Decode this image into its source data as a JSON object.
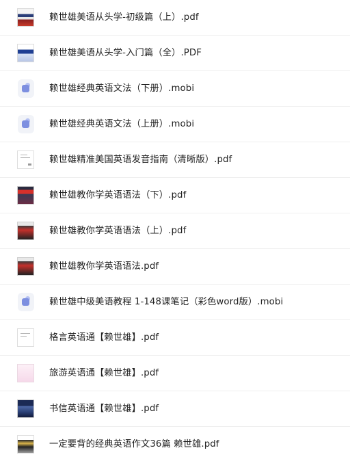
{
  "files": [
    {
      "name": "赖世雄美语从头学-初级篇（上）.pdf",
      "thumb": "book-cover-thumbnail"
    },
    {
      "name": "赖世雄美语从头学-入门篇（全）.PDF",
      "thumb": "book-cover-thumbnail"
    },
    {
      "name": "赖世雄经典英语文法（下册）.mobi",
      "thumb": "mobi-file-icon"
    },
    {
      "name": "赖世雄经典英语文法（上册）.mobi",
      "thumb": "mobi-file-icon"
    },
    {
      "name": "赖世雄精准美国英语发音指南（清晰版）.pdf",
      "thumb": "document-page-thumbnail"
    },
    {
      "name": "赖世雄教你学英语语法（下）.pdf",
      "thumb": "book-cover-thumbnail"
    },
    {
      "name": "赖世雄教你学英语语法（上）.pdf",
      "thumb": "book-cover-thumbnail"
    },
    {
      "name": "赖世雄教你学英语语法.pdf",
      "thumb": "book-cover-thumbnail"
    },
    {
      "name": "赖世雄中级美语教程 1-148课笔记（彩色word版）.mobi",
      "thumb": "mobi-file-icon"
    },
    {
      "name": "格言英语通【赖世雄】.pdf",
      "thumb": "document-page-thumbnail"
    },
    {
      "name": "旅游英语通【赖世雄】.pdf",
      "thumb": "book-cover-thumbnail"
    },
    {
      "name": "书信英语通【赖世雄】.pdf",
      "thumb": "book-cover-thumbnail"
    },
    {
      "name": "一定要背的经典英语作文36篇 赖世雄.pdf",
      "thumb": "book-cover-thumbnail"
    }
  ]
}
